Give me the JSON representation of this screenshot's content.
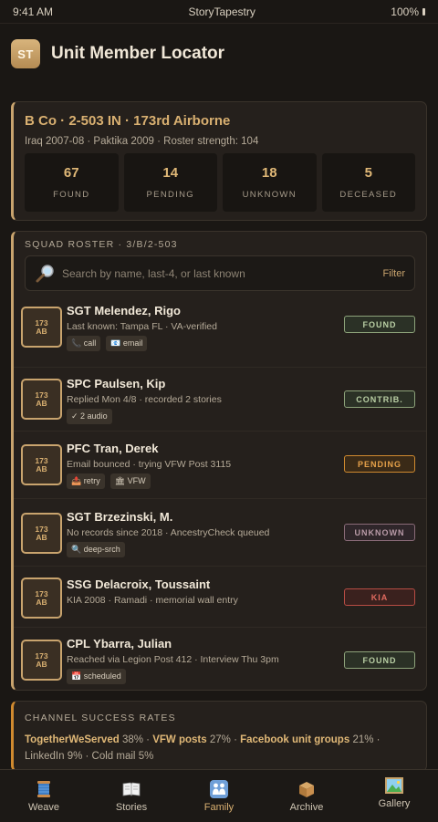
{
  "status_bar": {
    "time": "9:41 AM",
    "app": "StoryTapestry",
    "battery": "100%"
  },
  "header": {
    "logo_text": "ST",
    "title": "Unit Member Locator"
  },
  "unit": {
    "name": "B Co · 2-503 IN · 173rd Airborne",
    "subtitle": "Iraq 2007-08 · Paktika 2009 · Roster strength: 104",
    "stats": [
      {
        "value": "67",
        "label": "Found"
      },
      {
        "value": "14",
        "label": "Pending"
      },
      {
        "value": "18",
        "label": "Unknown"
      },
      {
        "value": "5",
        "label": "Deceased"
      }
    ]
  },
  "roster": {
    "section_label": "Squad Roster · 3/B/2-503",
    "search_placeholder": "Search by name, last-4, or last known",
    "filter_label": "Filter",
    "badge_top": "173",
    "badge_bottom": "AB",
    "members": [
      {
        "name": "SGT Melendez, Rigo",
        "detail": "Last known: Tampa FL · VA-verified",
        "chips": [
          "📞 call",
          "📧 email"
        ],
        "status": "Found",
        "status_class": "st-found"
      },
      {
        "name": "SPC Paulsen, Kip",
        "detail": "Replied Mon 4/8 · recorded 2 stories",
        "chips": [
          "✓ 2 audio"
        ],
        "status": "Contrib.",
        "status_class": "st-contrib"
      },
      {
        "name": "PFC Tran, Derek",
        "detail": "Email bounced · trying VFW Post 3115",
        "chips": [
          "📤 retry",
          "🏛 VFW"
        ],
        "status": "Pending",
        "status_class": "st-pending"
      },
      {
        "name": "SGT Brzezinski, M.",
        "detail": "No records since 2018 · AncestryCheck queued",
        "chips": [
          "🔍 deep-srch"
        ],
        "status": "Unknown",
        "status_class": "st-unknown"
      },
      {
        "name": "SSG Delacroix, Toussaint",
        "detail": "KIA 2008 · Ramadi · memorial wall entry",
        "chips": [],
        "status": "KIA",
        "status_class": "st-kia"
      },
      {
        "name": "CPL Ybarra, Julian",
        "detail": "Reached via Legion Post 412 · Interview Thu 3pm",
        "chips": [
          "📅 scheduled"
        ],
        "status": "Found",
        "status_class": "st-found"
      }
    ]
  },
  "channels": {
    "section_label": "Channel Success Rates",
    "items": [
      {
        "name": "TogetherWeServed",
        "rate": "38%"
      },
      {
        "name": "VFW posts",
        "rate": "27%"
      },
      {
        "name": "Facebook unit groups",
        "rate": "21%"
      },
      {
        "name": "LinkedIn",
        "rate": "9%"
      },
      {
        "name": "Cold mail",
        "rate": "5%"
      }
    ]
  },
  "tabs": [
    {
      "label": "Weave",
      "icon": "thread-spool-icon"
    },
    {
      "label": "Stories",
      "icon": "book-icon"
    },
    {
      "label": "Family",
      "icon": "family-icon",
      "active": true
    },
    {
      "label": "Archive",
      "icon": "archive-box-icon"
    },
    {
      "label": "Gallery",
      "icon": "gallery-icon"
    }
  ]
}
